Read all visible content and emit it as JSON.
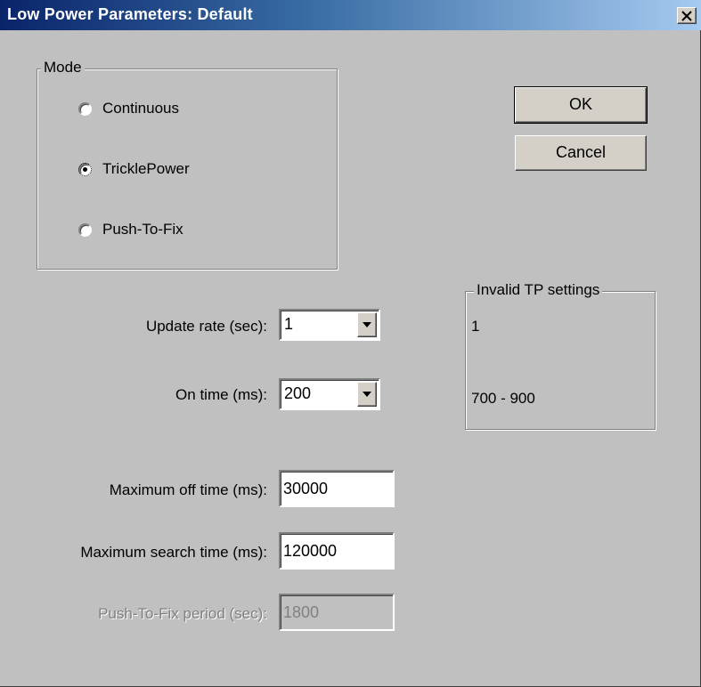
{
  "window": {
    "title": "Low Power Parameters: Default",
    "close_label": "✕"
  },
  "mode": {
    "legend": "Mode",
    "options": [
      {
        "label": "Continuous",
        "selected": false
      },
      {
        "label": "TricklePower",
        "selected": true
      },
      {
        "label": "Push-To-Fix",
        "selected": false
      }
    ]
  },
  "buttons": {
    "ok": "OK",
    "cancel": "Cancel"
  },
  "fields": {
    "update_rate": {
      "label": "Update rate (sec):",
      "value": "1"
    },
    "on_time": {
      "label": "On time (ms):",
      "value": "200"
    },
    "max_off_time": {
      "label": "Maximum off time (ms):",
      "value": "30000"
    },
    "max_search_time": {
      "label": "Maximum search time (ms):",
      "value": "120000"
    },
    "push_to_fix_period": {
      "label": "Push-To-Fix period (sec):",
      "value": "1800",
      "disabled": true
    }
  },
  "invalid_tp": {
    "legend": "Invalid TP settings",
    "update_rate_invalid": "1",
    "on_time_invalid": "700 - 900"
  }
}
